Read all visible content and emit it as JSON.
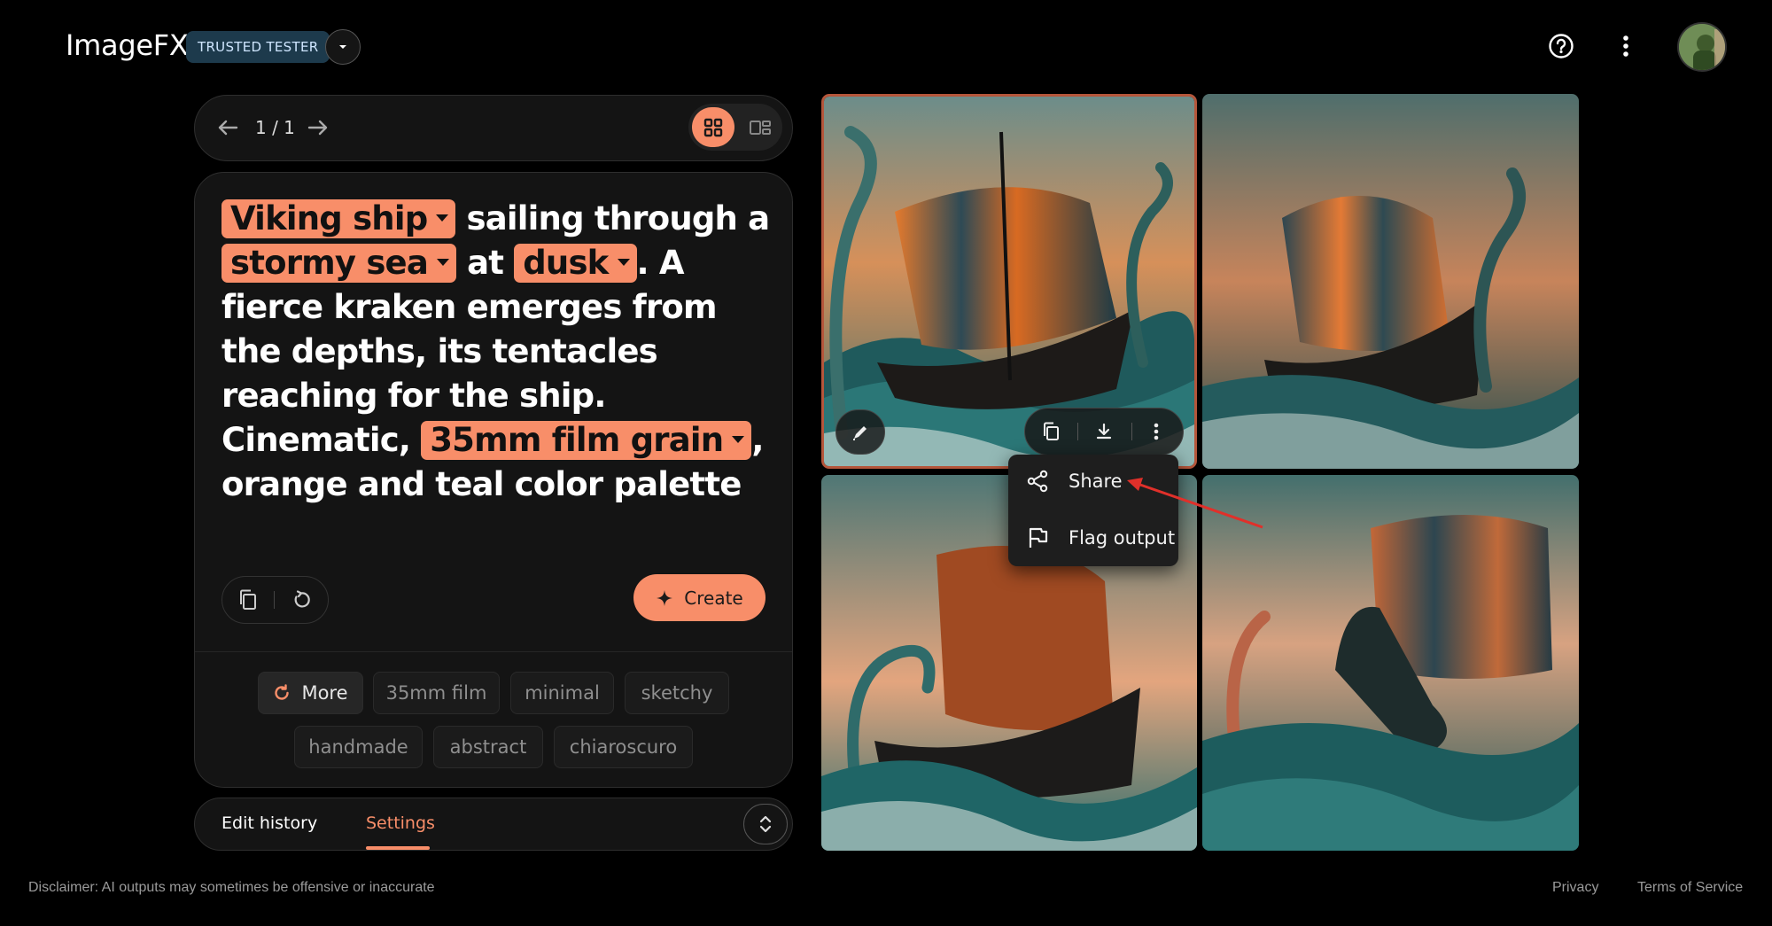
{
  "app": {
    "title": "ImageFX",
    "badge": "TRUSTED TESTER",
    "icons": [
      "chevron-down-icon",
      "help-icon",
      "more-vert-icon",
      "avatar"
    ]
  },
  "pager": {
    "count": "1 / 1",
    "icons": [
      "arrow-left-icon",
      "arrow-right-icon",
      "grid-view-icon",
      "single-view-icon"
    ],
    "active_view": "grid"
  },
  "prompt": {
    "segments": [
      {
        "type": "chip",
        "text": "Viking ship"
      },
      {
        "type": "text",
        "text": " sailing through a "
      },
      {
        "type": "chip",
        "text": "stormy sea"
      },
      {
        "type": "text",
        "text": " at "
      },
      {
        "type": "chip",
        "text": "dusk"
      },
      {
        "type": "text",
        "text": ". A fierce kraken emerges from the depths, its tentacles reaching for the ship. Cinematic, "
      },
      {
        "type": "chip",
        "text": "35mm film grain"
      },
      {
        "type": "text",
        "text": ", orange and teal color palette"
      }
    ],
    "create_label": "Create",
    "icons": [
      "copy-icon",
      "reset-icon",
      "sparkle-icon"
    ]
  },
  "styles": {
    "more_label": "More",
    "chips": [
      "35mm film",
      "minimal",
      "sketchy",
      "handmade",
      "abstract",
      "chiaroscuro"
    ]
  },
  "tabs": {
    "edit_history": "Edit history",
    "settings": "Settings",
    "active": "settings"
  },
  "images": {
    "count": 4,
    "selected": 1,
    "overlay_icons": [
      "edit-icon",
      "copy-icon",
      "download-icon",
      "more-vert-icon"
    ]
  },
  "context_menu": {
    "items": [
      {
        "label": "Share",
        "icon": "share-icon"
      },
      {
        "label": "Flag output",
        "icon": "flag-icon"
      }
    ]
  },
  "footer": {
    "disclaimer": "Disclaimer: AI outputs may sometimes be offensive or inaccurate",
    "privacy": "Privacy",
    "terms": "Terms of Service"
  },
  "colors": {
    "accent": "#f88e69",
    "background": "#000000",
    "card": "#141414",
    "badge_bg": "#1d3a4c",
    "selected_border": "#b5563b",
    "annotation_arrow": "#e0302a"
  }
}
